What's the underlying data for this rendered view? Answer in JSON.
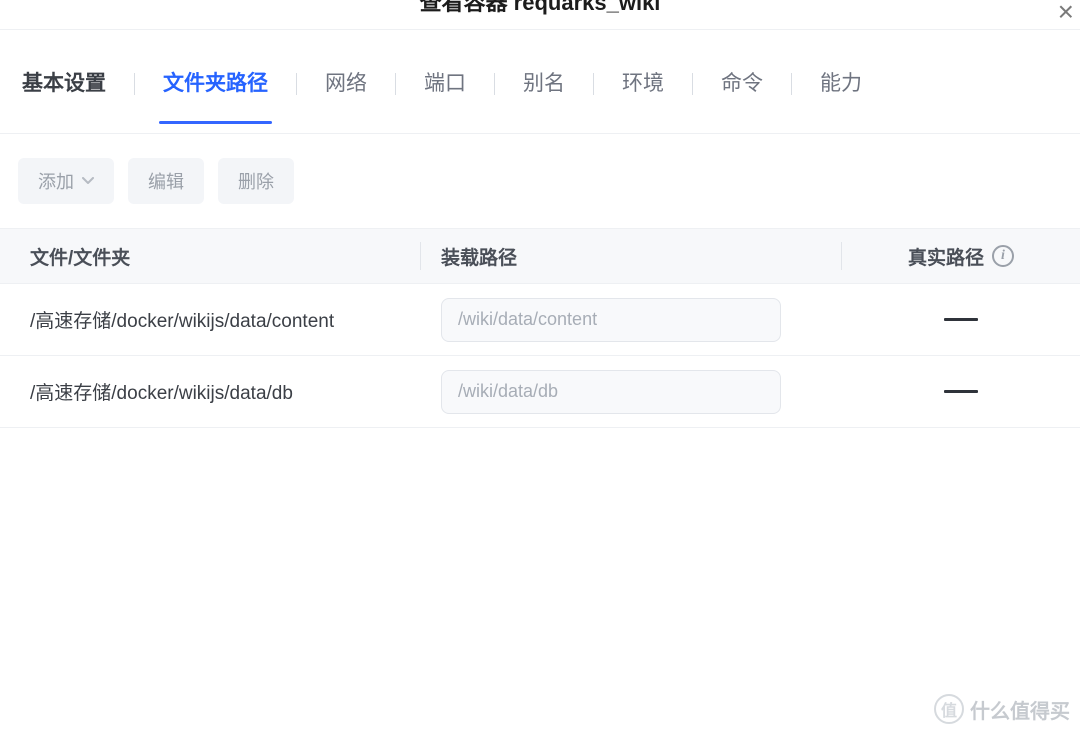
{
  "header": {
    "title": "查看容器 requarks_wiki"
  },
  "tabs": {
    "items": [
      {
        "label": "基本设置",
        "active": false
      },
      {
        "label": "文件夹路径",
        "active": true
      },
      {
        "label": "网络",
        "active": false
      },
      {
        "label": "端口",
        "active": false
      },
      {
        "label": "别名",
        "active": false
      },
      {
        "label": "环境",
        "active": false
      },
      {
        "label": "命令",
        "active": false
      },
      {
        "label": "能力",
        "active": false
      }
    ]
  },
  "toolbar": {
    "add_label": "添加",
    "edit_label": "编辑",
    "delete_label": "删除"
  },
  "table": {
    "headers": {
      "file_folder": "文件/文件夹",
      "mount_path": "装载路径",
      "real_path": "真实路径"
    },
    "rows": [
      {
        "file_folder": "/高速存储/docker/wikijs/data/content",
        "mount_path": "/wiki/data/content",
        "real_path": "——"
      },
      {
        "file_folder": "/高速存储/docker/wikijs/data/db",
        "mount_path": "/wiki/data/db",
        "real_path": "——"
      }
    ]
  },
  "watermark": {
    "badge": "值",
    "text": "什么值得买"
  }
}
